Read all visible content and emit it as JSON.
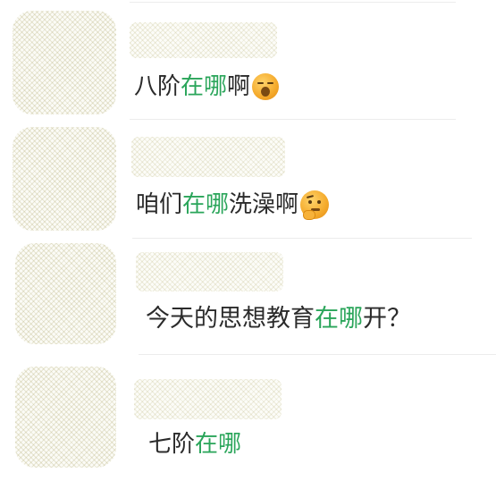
{
  "messages": [
    {
      "segments": [
        {
          "text": "八阶",
          "highlight": false
        },
        {
          "text": "在哪",
          "highlight": true
        },
        {
          "text": "啊",
          "highlight": false
        }
      ],
      "emoji": "tired-face-emoji"
    },
    {
      "segments": [
        {
          "text": "咱们",
          "highlight": false
        },
        {
          "text": "在哪",
          "highlight": true
        },
        {
          "text": "洗澡啊",
          "highlight": false
        }
      ],
      "emoji": "thinking-face-emoji"
    },
    {
      "segments": [
        {
          "text": "今天的思想教育",
          "highlight": false
        },
        {
          "text": "在哪",
          "highlight": true
        },
        {
          "text": "开？",
          "highlight": false
        }
      ],
      "emoji": ""
    },
    {
      "segments": [
        {
          "text": "七阶",
          "highlight": false
        },
        {
          "text": "在哪",
          "highlight": true
        }
      ],
      "emoji": ""
    }
  ],
  "colors": {
    "highlight": "#2aa55a",
    "text": "#2b2b2b",
    "divider": "#ececec"
  }
}
